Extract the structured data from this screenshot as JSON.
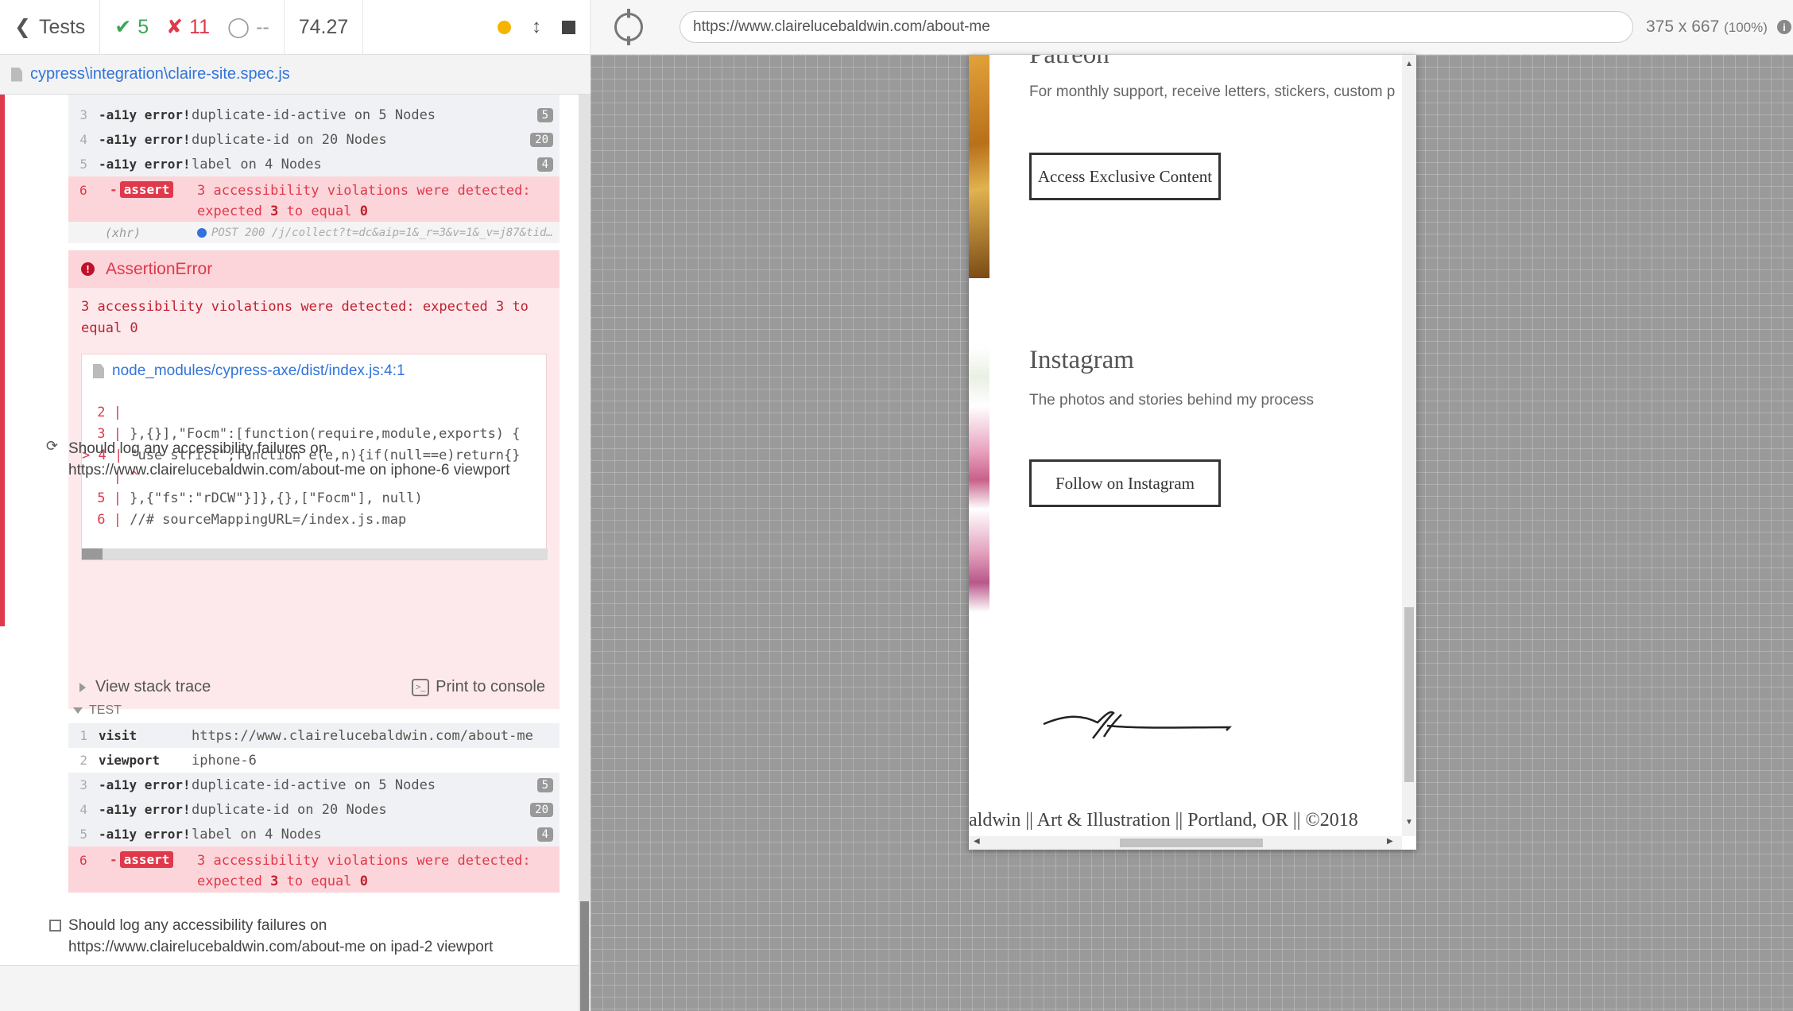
{
  "header": {
    "tests_label": "Tests",
    "passed": "5",
    "failed": "11",
    "pending": "--",
    "duration": "74.27"
  },
  "spec": {
    "path": "cypress\\integration\\claire-site.spec.js"
  },
  "test1": {
    "commands": [
      {
        "num": "3",
        "name": "-a11y error!",
        "msg": "duplicate-id-active on 5 Nodes",
        "badge": "5"
      },
      {
        "num": "4",
        "name": "-a11y error!",
        "msg": "duplicate-id on 20 Nodes",
        "badge": "20"
      },
      {
        "num": "5",
        "name": "-a11y error!",
        "msg": "label on 4 Nodes",
        "badge": "4"
      }
    ],
    "assert": {
      "num": "6",
      "name": "-",
      "tag": "assert",
      "line1": "3 accessibility violations were detected:",
      "line2_pre": "expected ",
      "line2_a": "3",
      "line2_mid": " to equal ",
      "line2_b": "0"
    },
    "xhr": {
      "name": "(xhr)",
      "msg": "POST 200 /j/collect?t=dc&aip=1&_r=3&v=1&_v=j87&tid…"
    }
  },
  "error": {
    "title": "AssertionError",
    "message": "3 accessibility violations were detected: expected 3 to equal 0",
    "file": "node_modules/cypress-axe/dist/index.js:4:1",
    "code_lines": [
      {
        "ln": "2 |",
        "code": ""
      },
      {
        "ln": "3 |",
        "code": " },{}],\"Focm\":[function(require,module,exports) {"
      },
      {
        "ln": "> 4 |",
        "code": " \"use strict\";function e(e,n){if(null==e)return{}"
      },
      {
        "ln": "|",
        "code": " ^"
      },
      {
        "ln": "5 |",
        "code": " },{\"fs\":\"rDCW\"}]},{},[\"Focm\"], null)"
      },
      {
        "ln": "6 |",
        "code": " //# sourceMappingURL=/index.js.map"
      }
    ],
    "view_stack": "View stack trace",
    "print_console": "Print to console"
  },
  "test2": {
    "title": "Should log any accessibility failures on https://www.clairelucebaldwin.com/about-me on iphone-6 viewport",
    "section": "TEST",
    "commands": [
      {
        "num": "1",
        "name": "visit",
        "msg": "https://www.clairelucebaldwin.com/about-me",
        "badge": ""
      },
      {
        "num": "2",
        "name": "viewport",
        "msg": "iphone-6",
        "badge": ""
      },
      {
        "num": "3",
        "name": "-a11y error!",
        "msg": "duplicate-id-active on 5 Nodes",
        "badge": "5"
      },
      {
        "num": "4",
        "name": "-a11y error!",
        "msg": "duplicate-id on 20 Nodes",
        "badge": "20"
      },
      {
        "num": "5",
        "name": "-a11y error!",
        "msg": "label on 4 Nodes",
        "badge": "4"
      }
    ],
    "assert": {
      "num": "6",
      "name": "-",
      "tag": "assert",
      "line1": "3 accessibility violations were detected:",
      "line2_pre": "expected ",
      "line2_a": "3",
      "line2_mid": " to equal ",
      "line2_b": "0"
    }
  },
  "test3": {
    "title": "Should log any accessibility failures on https://www.clairelucebaldwin.com/about-me on ipad-2 viewport"
  },
  "aut": {
    "url": "https://www.clairelucebaldwin.com/about-me",
    "size": "375 x 667",
    "zoom": "(100%)"
  },
  "site": {
    "patreon_heading": "Patreon",
    "patreon_text": "For monthly support, receive letters, stickers, custom p",
    "patreon_button": "Access Exclusive Content",
    "instagram_heading": "Instagram",
    "instagram_text": "The photos and stories behind my process",
    "instagram_button": "Follow on Instagram",
    "footer": "aldwin || Art & Illustration || Portland, OR || ©2018"
  }
}
